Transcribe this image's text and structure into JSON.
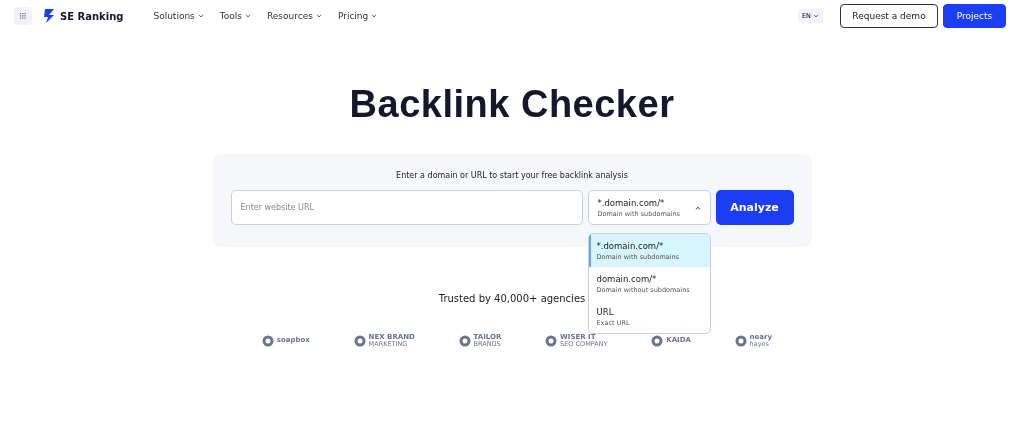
{
  "nav": {
    "brand": "SE Ranking",
    "menu": [
      {
        "label": "Solutions"
      },
      {
        "label": "Tools"
      },
      {
        "label": "Resources"
      },
      {
        "label": "Pricing"
      }
    ],
    "language": "EN",
    "buttons": [
      {
        "label": "Request a demo",
        "kind": "outline"
      },
      {
        "label": "Projects",
        "kind": "primary"
      }
    ]
  },
  "title": "Backlink Checker",
  "search": {
    "prompt": "Enter a domain or URL to start your free backlink analysis",
    "placeholder": "Enter website URL",
    "scope": {
      "value": "*.domain.com/*",
      "hint": "Domain with subdomains",
      "expanded": true
    },
    "button": "Analyze",
    "options": [
      {
        "value": "*.domain.com/*",
        "hint": "Domain with subdomains",
        "selected": true
      },
      {
        "value": "domain.com/*",
        "hint": "Domain without subdomains",
        "selected": false
      },
      {
        "value": "URL",
        "hint": "Exact URL",
        "selected": false
      }
    ]
  },
  "trusted": "Trusted by 40,000+ agencies",
  "logos": [
    {
      "name": "soapbox"
    },
    {
      "name": "NEX BRAND",
      "sub": "MARKETING"
    },
    {
      "name": "TAILOR",
      "sub": "BRANDS"
    },
    {
      "name": "WISER IT",
      "sub": "SEO COMPANY"
    },
    {
      "name": "KAIDA"
    },
    {
      "name": "neary",
      "sub": "hayes"
    }
  ]
}
